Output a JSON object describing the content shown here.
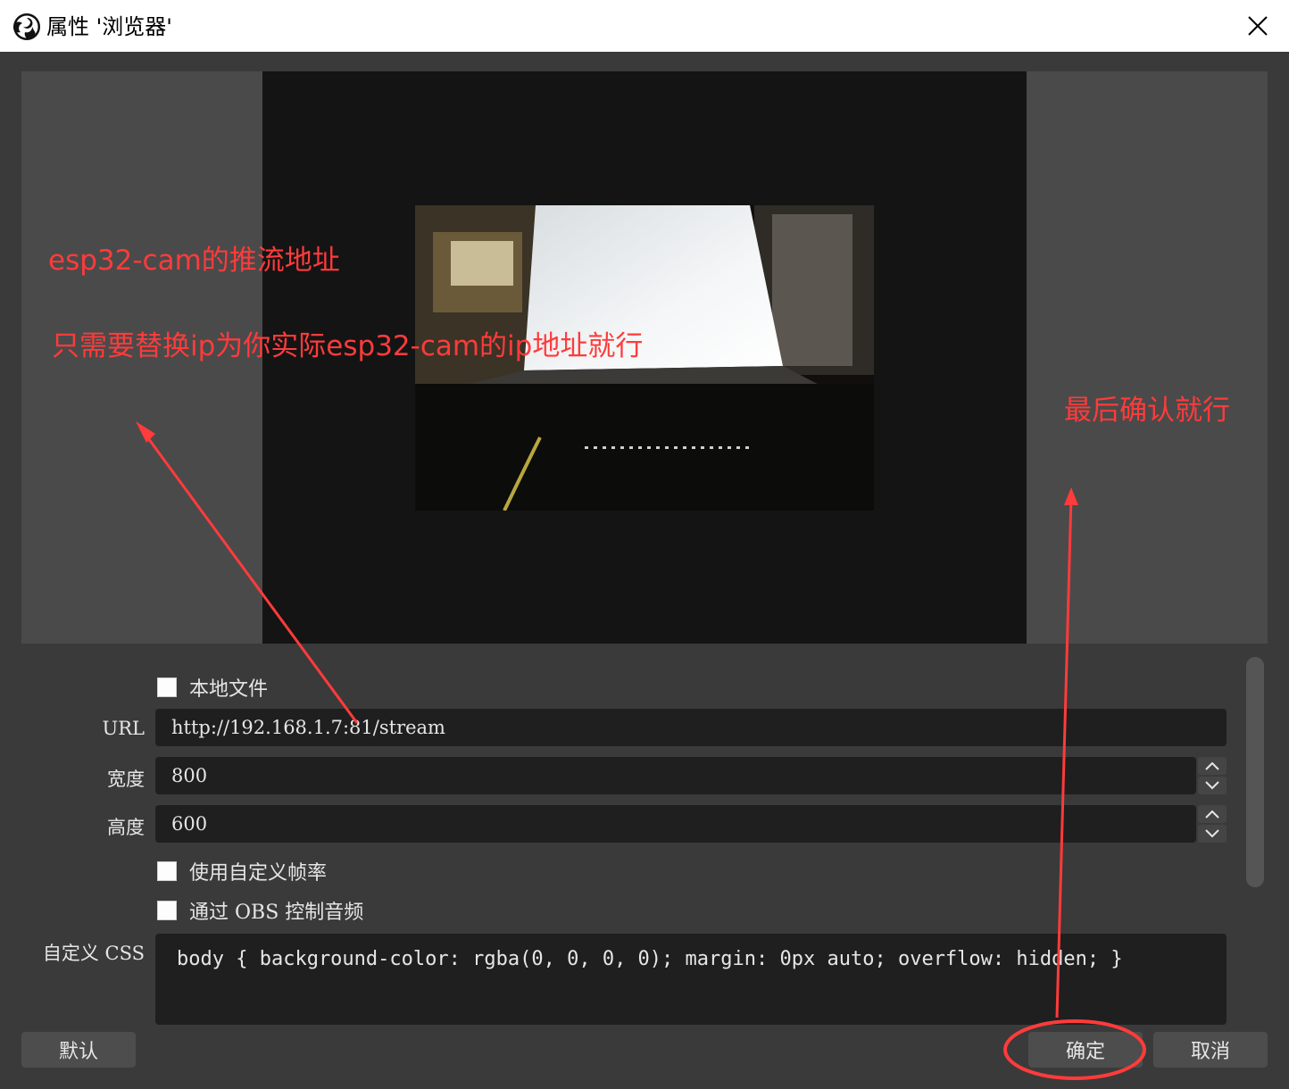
{
  "window": {
    "title": "属性 '浏览器'",
    "app_icon": "obs-logo-icon",
    "close_icon": "close-icon"
  },
  "properties": {
    "local_file_label": "本地文件",
    "url_label": "URL",
    "url_value": "http://192.168.1.7:81/stream",
    "width_label": "宽度",
    "width_value": "800",
    "height_label": "高度",
    "height_value": "600",
    "custom_fps_label": "使用自定义帧率",
    "control_audio_label": "通过 OBS 控制音频",
    "custom_css_label": "自定义 CSS",
    "custom_css_value": "body { background-color: rgba(0, 0, 0, 0); margin: 0px auto; overflow: hidden; }"
  },
  "buttons": {
    "defaults": "默认",
    "ok": "确定",
    "cancel": "取消"
  },
  "annotations": {
    "left_line1": "esp32-cam的推流地址",
    "left_line2": "只需要替换ip为你实际esp32-cam的ip地址就行",
    "right_text": "最后确认就行",
    "color": "#ff3b3b"
  },
  "colors": {
    "dialog_bg": "#3a3a3a",
    "preview_side": "#4a4a4a",
    "preview_canvas": "#141414",
    "input_bg": "#1f1f1f",
    "button_bg": "#4d4d4d"
  }
}
